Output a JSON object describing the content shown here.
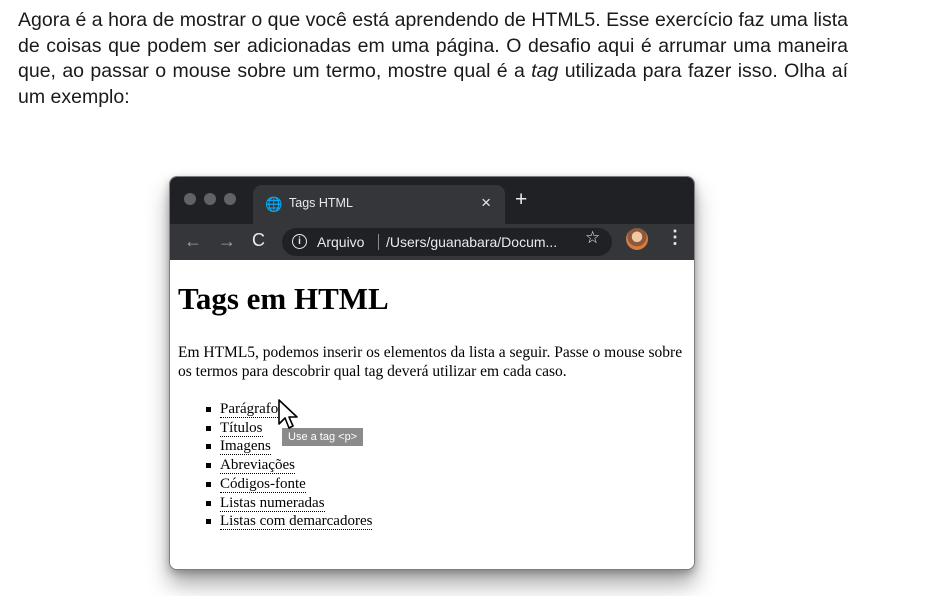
{
  "intro": {
    "text_before": "Agora é a hora de mostrar o que você está aprendendo de HTML5. Esse exercício faz uma lista de coisas que podem ser adicionadas em uma página. O desafio aqui é arrumar uma maneira que, ao passar o mouse sobre um termo, mostre qual é a ",
    "em": "tag",
    "text_after": " utilizada para fazer isso. Olha aí um exemplo:"
  },
  "browser": {
    "tab_title": "Tags HTML",
    "tab_close": "×",
    "new_tab": "+",
    "back": "←",
    "forward": "→",
    "reload": "C",
    "info_icon": "i",
    "file_label": "Arquivo",
    "url": "/Users/guanabara/Docum...",
    "star": "☆",
    "menu": "⋮"
  },
  "page": {
    "title": "Tags em HTML",
    "paragraph": "Em HTML5, podemos inserir os elementos da lista a seguir. Passe o mouse sobre os termos para descobrir qual tag deverá utilizar em cada caso.",
    "items": [
      "Parágrafo",
      "Títulos",
      "Imagens",
      "Abreviações",
      "Códigos-fonte",
      "Listas numeradas",
      "Listas com demarcadores"
    ],
    "tooltip": "Use a tag <p>"
  },
  "colors": {
    "titlebar": "#202124",
    "toolbar": "#35363a",
    "tooltip_bg": "#8b8b8b"
  }
}
